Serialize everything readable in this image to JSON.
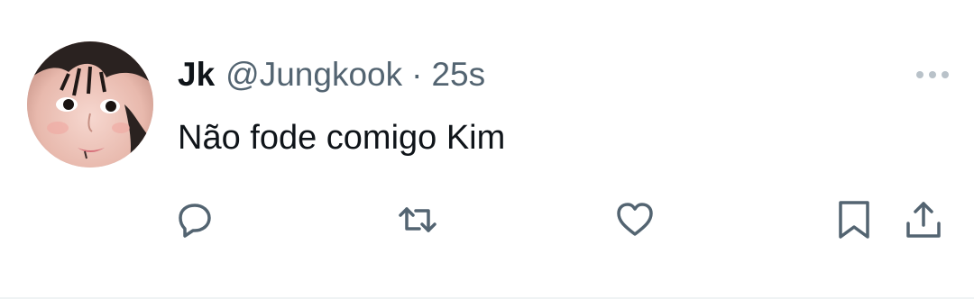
{
  "tweet": {
    "display_name": "Jk",
    "handle": "@Jungkook",
    "separator": "·",
    "timestamp": "25s",
    "text": "Não fode comigo Kim"
  },
  "icons": {
    "more": "more-horizontal-icon",
    "reply": "reply-icon",
    "retweet": "retweet-icon",
    "like": "heart-icon",
    "bookmark": "bookmark-icon",
    "share": "share-icon"
  },
  "colors": {
    "primary_text": "#0f1419",
    "secondary_text": "#536471",
    "icon": "#536471",
    "divider": "#eff3f4"
  }
}
